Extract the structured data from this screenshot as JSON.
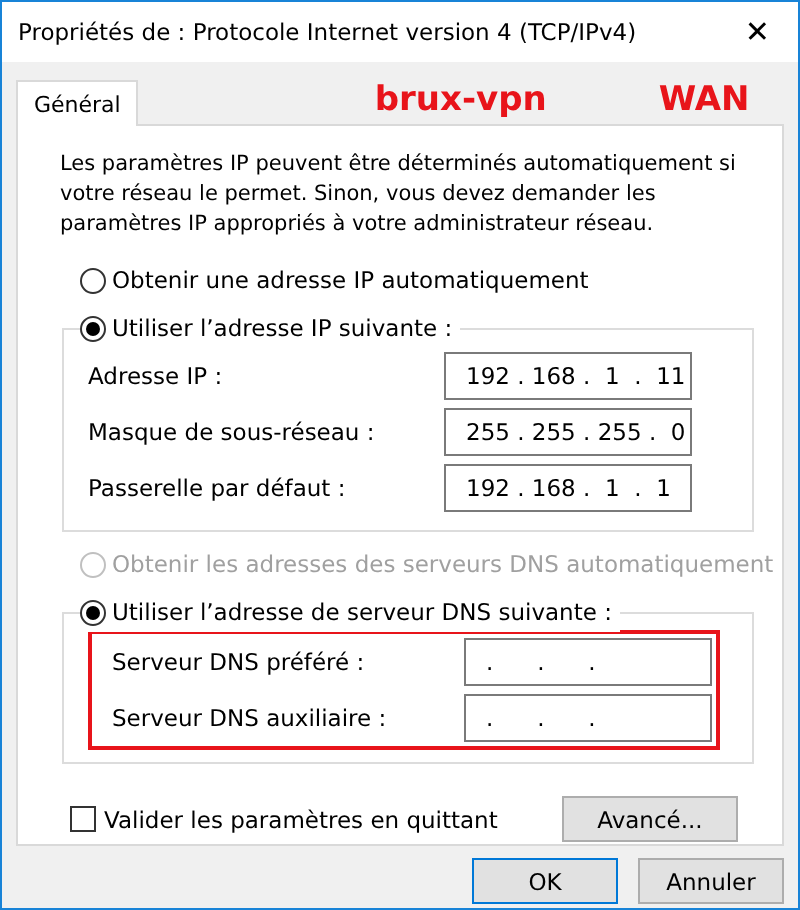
{
  "window": {
    "title": "Propriétés de : Protocole Internet version 4 (TCP/IPv4)",
    "close": "✕"
  },
  "tabs": [
    {
      "label": "Général",
      "selected": true
    }
  ],
  "annotations": [
    {
      "text": "brux-vpn"
    },
    {
      "text": "WAN"
    }
  ],
  "intro": "Les paramètres IP peuvent être déterminés automatiquement si votre réseau le permet. Sinon, vous devez demander les paramètres IP appropriés à votre administrateur réseau.",
  "ip": {
    "options": [
      {
        "label": "Obtenir une adresse IP automatiquement",
        "selected": false,
        "disabled": false
      },
      {
        "label": "Utiliser l’adresse IP suivante :",
        "selected": true,
        "disabled": false
      }
    ],
    "fields": [
      {
        "label": "Adresse IP :",
        "value": "192 . 168 .  1  .  11"
      },
      {
        "label": "Masque de sous-réseau :",
        "value": "255 . 255 . 255 .  0"
      },
      {
        "label": "Passerelle par défaut :",
        "value": "192 . 168 .  1  .  1"
      }
    ]
  },
  "dns": {
    "options": [
      {
        "label": "Obtenir les adresses des serveurs DNS automatiquement",
        "selected": false,
        "disabled": true
      },
      {
        "label": "Utiliser l’adresse de serveur DNS suivante :",
        "selected": true,
        "disabled": false
      }
    ],
    "highlighted": true,
    "fields": [
      {
        "label": "Serveur DNS préféré :",
        "value": ".      .      ."
      },
      {
        "label": "Serveur DNS auxiliaire :",
        "value": ".      .      ."
      }
    ]
  },
  "validate": {
    "label": "Valider les paramètres en quittant",
    "checked": false
  },
  "advanced_button": "Avancé...",
  "buttons": [
    "OK",
    "Annuler"
  ]
}
